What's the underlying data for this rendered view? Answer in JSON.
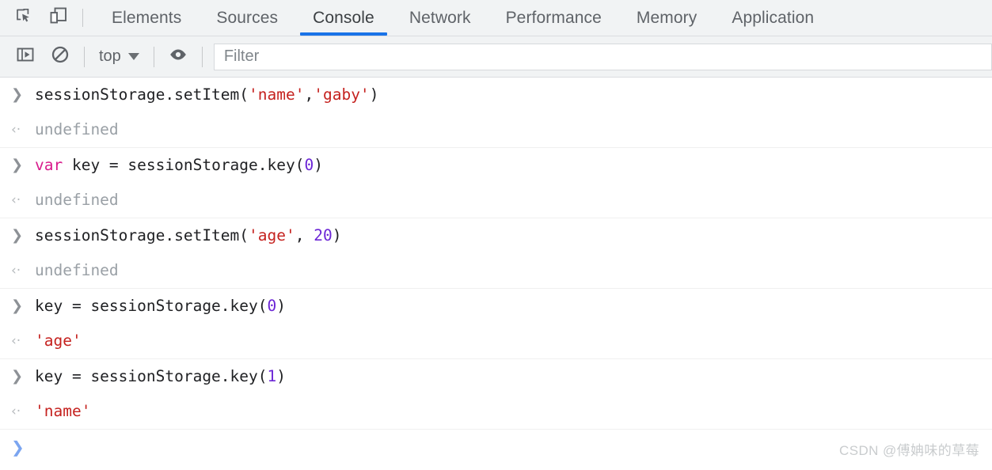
{
  "colors": {
    "accent": "#1a73e8",
    "header_bg": "#f1f3f4",
    "body_bg": "#ffffff",
    "string_literal": "#c5221f",
    "keyword": "#d81b8c",
    "number_literal": "#6c26d6",
    "undefined_text": "#9aa0a6",
    "prompt_blue": "#7ba5f0"
  },
  "tabbar": {
    "inspect_icon": "inspect-element-icon",
    "device_icon": "device-toolbar-icon",
    "tabs": [
      {
        "label": "Elements",
        "active": false
      },
      {
        "label": "Sources",
        "active": false
      },
      {
        "label": "Console",
        "active": true
      },
      {
        "label": "Network",
        "active": false
      },
      {
        "label": "Performance",
        "active": false
      },
      {
        "label": "Memory",
        "active": false
      },
      {
        "label": "Application",
        "active": false
      }
    ]
  },
  "toolbar": {
    "sidebar_toggle_icon": "console-sidebar-toggle-icon",
    "clear_console_icon": "clear-console-icon",
    "context_label": "top",
    "context_caret_icon": "chevron-down-icon",
    "eye_icon": "live-expression-eye-icon",
    "filter": {
      "placeholder": "Filter",
      "value": ""
    }
  },
  "console": {
    "input_marker": "❯",
    "output_marker": "‹·",
    "prompt_marker": "❯",
    "entries": [
      {
        "kind": "input",
        "text": "sessionStorage.setItem('name','gaby')",
        "tokens": [
          {
            "t": "sessionStorage.setItem(",
            "c": "plain"
          },
          {
            "t": "'name'",
            "c": "str"
          },
          {
            "t": ",",
            "c": "plain"
          },
          {
            "t": "'gaby'",
            "c": "str"
          },
          {
            "t": ")",
            "c": "plain"
          }
        ]
      },
      {
        "kind": "output",
        "text": "undefined",
        "style": "undef"
      },
      {
        "kind": "input",
        "text": "var key = sessionStorage.key(0)",
        "tokens": [
          {
            "t": "var",
            "c": "kw"
          },
          {
            "t": " key = sessionStorage.key(",
            "c": "plain"
          },
          {
            "t": "0",
            "c": "num"
          },
          {
            "t": ")",
            "c": "plain"
          }
        ]
      },
      {
        "kind": "output",
        "text": "undefined",
        "style": "undef"
      },
      {
        "kind": "input",
        "text": "sessionStorage.setItem('age', 20)",
        "tokens": [
          {
            "t": "sessionStorage.setItem(",
            "c": "plain"
          },
          {
            "t": "'age'",
            "c": "str"
          },
          {
            "t": ", ",
            "c": "plain"
          },
          {
            "t": "20",
            "c": "num"
          },
          {
            "t": ")",
            "c": "plain"
          }
        ]
      },
      {
        "kind": "output",
        "text": "undefined",
        "style": "undef"
      },
      {
        "kind": "input",
        "text": "key = sessionStorage.key(0)",
        "tokens": [
          {
            "t": "key = sessionStorage.key(",
            "c": "plain"
          },
          {
            "t": "0",
            "c": "num"
          },
          {
            "t": ")",
            "c": "plain"
          }
        ]
      },
      {
        "kind": "output",
        "text": "'age'",
        "style": "str"
      },
      {
        "kind": "input",
        "text": "key = sessionStorage.key(1)",
        "tokens": [
          {
            "t": "key = sessionStorage.key(",
            "c": "plain"
          },
          {
            "t": "1",
            "c": "num"
          },
          {
            "t": ")",
            "c": "plain"
          }
        ]
      },
      {
        "kind": "output",
        "text": "'name'",
        "style": "str"
      },
      {
        "kind": "prompt",
        "text": ""
      }
    ]
  },
  "watermark": {
    "text": "CSDN @傅姌味的草莓"
  }
}
